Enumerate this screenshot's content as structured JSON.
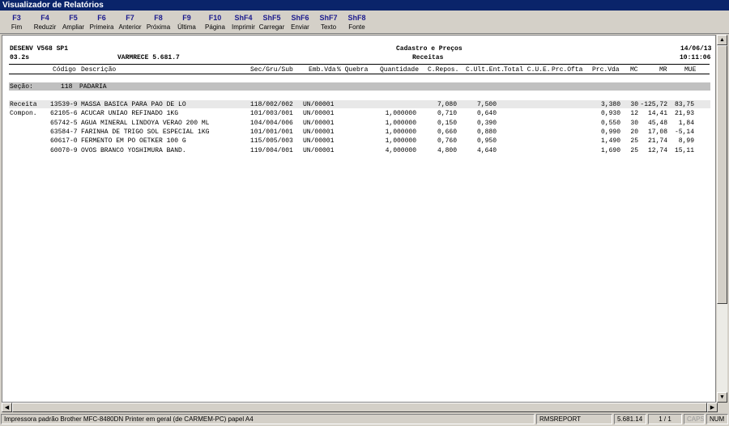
{
  "window": {
    "title": "Visualizador de Relatórios"
  },
  "toolbar": [
    {
      "key": "F3",
      "label": "Fim"
    },
    {
      "key": "F4",
      "label": "Reduzir"
    },
    {
      "key": "F5",
      "label": "Ampliar"
    },
    {
      "key": "F6",
      "label": "Primeira"
    },
    {
      "key": "F7",
      "label": "Anterior"
    },
    {
      "key": "F8",
      "label": "Próxima"
    },
    {
      "key": "F9",
      "label": "Última"
    },
    {
      "key": "F10",
      "label": "Página"
    },
    {
      "key": "ShF4",
      "label": "Imprimir"
    },
    {
      "key": "ShF5",
      "label": "Carregar"
    },
    {
      "key": "ShF6",
      "label": "Enviar"
    },
    {
      "key": "ShF7",
      "label": "Texto"
    },
    {
      "key": "ShF8",
      "label": "Fonte"
    }
  ],
  "report": {
    "company": "DESENV V568 SP1",
    "version": "03.2s",
    "program": "VARMRECE 5.681.7",
    "title": "Cadastro e Preços",
    "subtitle": "Receitas",
    "date": "14/06/13",
    "time": "10:11:06",
    "columns": {
      "codigo": "Código",
      "descricao": "Descrição",
      "secgrusub": "Sec/Gru/Sub",
      "embvda": "Emb.Vda",
      "quebra": "% Quebra",
      "quantidade": "Quantidade",
      "crepos": "C.Repos.",
      "cultent": "C.Ult.Ent.",
      "totalcue": "Total C.U.E.",
      "prcofta": "Prc.Ofta",
      "prcvda": "Prc.Vda",
      "mc": "MC",
      "mr": "MR",
      "mue": "MUE"
    },
    "section": {
      "label": "Seção:",
      "code": "118",
      "name": "PADARIA"
    },
    "rows": [
      {
        "tipo": "Receita",
        "codigo": "13539-9",
        "descricao": "MASSA BASICA PARA PAO DE LO",
        "secgrusub": "118/002/002",
        "embvda": "UN/00001",
        "quantidade": "",
        "crepos": "7,080",
        "cultent": "7,500",
        "prcvda": "3,380",
        "mc": "30",
        "mr": "-125,72",
        "mue": "83,75"
      },
      {
        "tipo": "Compon.",
        "codigo": "62105-6",
        "descricao": "ACUCAR UNIAO REFINADO 1KG",
        "secgrusub": "101/003/001",
        "embvda": "UN/00001",
        "quantidade": "1,000000",
        "crepos": "0,710",
        "cultent": "0,640",
        "prcvda": "0,930",
        "mc": "12",
        "mr": "14,41",
        "mue": "21,93"
      },
      {
        "tipo": "",
        "codigo": "65742-5",
        "descricao": "AGUA MINERAL LINDOYA VERAO 200 ML",
        "secgrusub": "104/004/006",
        "embvda": "UN/00001",
        "quantidade": "1,000000",
        "crepos": "0,150",
        "cultent": "0,390",
        "prcvda": "0,550",
        "mc": "30",
        "mr": "45,48",
        "mue": "1,84"
      },
      {
        "tipo": "",
        "codigo": "63584-7",
        "descricao": "FARINHA DE TRIGO SOL ESPECIAL 1KG",
        "secgrusub": "101/001/001",
        "embvda": "UN/00001",
        "quantidade": "1,000000",
        "crepos": "0,660",
        "cultent": "0,880",
        "prcvda": "0,990",
        "mc": "20",
        "mr": "17,08",
        "mue": "-5,14"
      },
      {
        "tipo": "",
        "codigo": "60617-0",
        "descricao": "FERMENTO EM PO OETKER 100 G",
        "secgrusub": "115/005/003",
        "embvda": "UN/00001",
        "quantidade": "1,000000",
        "crepos": "0,760",
        "cultent": "0,950",
        "prcvda": "1,490",
        "mc": "25",
        "mr": "21,74",
        "mue": "8,99"
      },
      {
        "tipo": "",
        "codigo": "60070-9",
        "descricao": "OVOS BRANCO YOSHIMURA BAND.",
        "secgrusub": "119/004/001",
        "embvda": "UN/00001",
        "quantidade": "4,000000",
        "crepos": "4,800",
        "cultent": "4,640",
        "prcvda": "1,690",
        "mc": "25",
        "mr": "12,74",
        "mue": "15,11"
      }
    ]
  },
  "status": {
    "printer": "Impressora padrão Brother MFC-8480DN Printer em geral (de CARMEM-PC) papel A4",
    "module": "RMSREPORT",
    "version": "5.681.14",
    "pages": "1 / 1",
    "caps": "CAPS",
    "num": "NUM"
  },
  "icons": [
    "arrow-up-icon",
    "arrow-down-icon",
    "arrow-left-icon",
    "arrow-right-icon"
  ]
}
